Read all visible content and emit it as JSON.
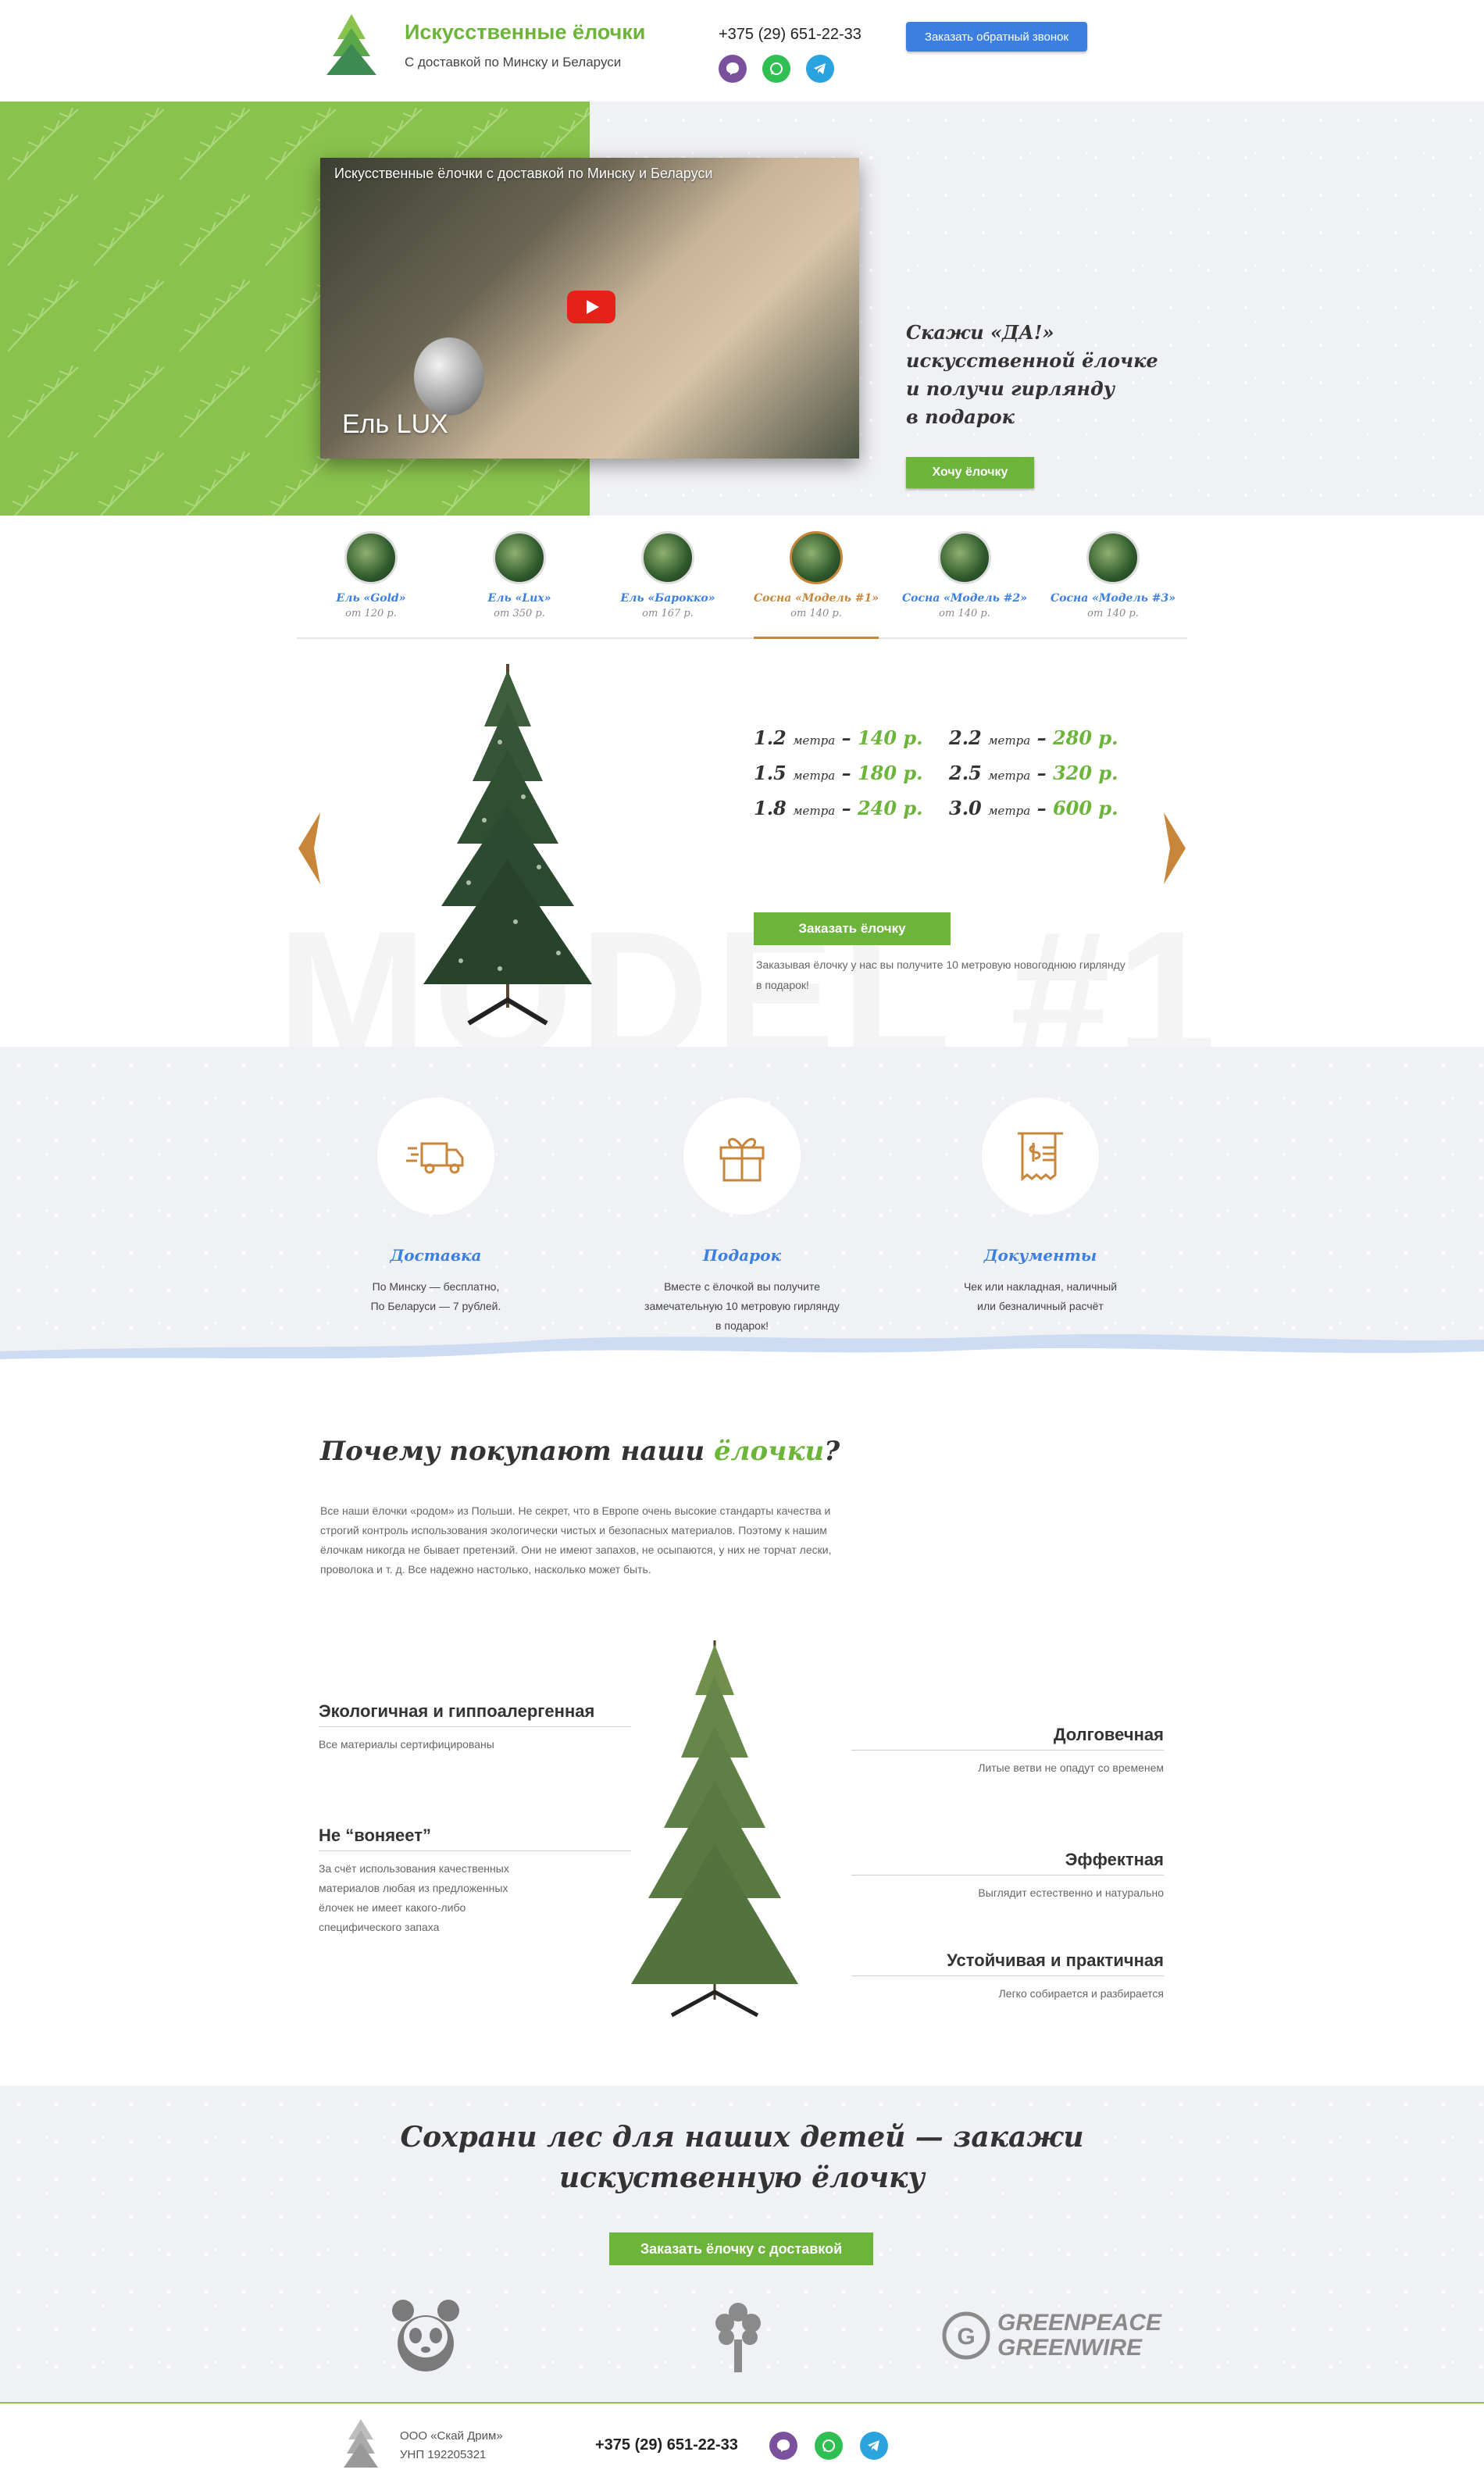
{
  "header": {
    "title": "Искусственные ёлочки",
    "subtitle": "С доставкой по Минску и Беларуси",
    "phone": "+375 (29) 651-22-33",
    "callback_label": "Заказать обратный звонок",
    "messengers": [
      "viber-icon",
      "whatsapp-icon",
      "telegram-icon"
    ]
  },
  "hero": {
    "video_title": "Искусственные ёлочки с доставкой по Минску и Беларуси",
    "video_caption": "Ель LUX",
    "headline_lines": [
      "Скажи «ДА!»",
      "искусственной ёлочке",
      "и получи гирлянду",
      "в подарок"
    ],
    "cta_label": "Хочу ёлочку"
  },
  "models": [
    {
      "name": "Ель «Gold»",
      "price": "от 120 р."
    },
    {
      "name": "Ель «Lux»",
      "price": "от 350 р."
    },
    {
      "name": "Ель «Барокко»",
      "price": "от 167 р."
    },
    {
      "name": "Сосна «Модель #1»",
      "price": "от 140 р.",
      "active": true
    },
    {
      "name": "Сосна «Модель #2»",
      "price": "от 140 р."
    },
    {
      "name": "Сосна «Модель #3»",
      "price": "от 140 р."
    }
  ],
  "product": {
    "watermark": "MODEL #1",
    "metre_word": "метра",
    "prices": [
      {
        "size": "1.2",
        "price": "140 р."
      },
      {
        "size": "2.2",
        "price": "280 р."
      },
      {
        "size": "1.5",
        "price": "180 р."
      },
      {
        "size": "2.5",
        "price": "320 р."
      },
      {
        "size": "1.8",
        "price": "240 р."
      },
      {
        "size": "3.0",
        "price": "600 р."
      }
    ],
    "order_label": "Заказать ёлочку",
    "order_note": "Заказывая ёлочку у нас вы получите 10 метровую новогоднюю гирлянду в подарок!"
  },
  "features": [
    {
      "icon": "truck-icon",
      "title": "Доставка",
      "text": "По Минску — бесплатно,\nПо Беларуси — 7 рублей."
    },
    {
      "icon": "gift-icon",
      "title": "Подарок",
      "text": "Вместе с ёлочкой вы получите\nзамечательную 10 метровую гирлянду\nв подарок!"
    },
    {
      "icon": "receipt-icon",
      "title": "Документы",
      "text": "Чек или накладная, наличный\nили безналичный расчёт"
    }
  ],
  "why": {
    "title_prefix": "Почему покупают наши ",
    "title_accent": "ёлочки",
    "title_suffix": "?",
    "text": "Все наши ёлочки «родом» из Польши. Не секрет, что в Европе очень высокие стандарты качества и строгий контроль использования экологически чистых и безопасных материалов. Поэтому к нашим ёлочкам никогда не бывает претензий. Они не имеют запахов, не осыпаются, у них не торчат лески, проволока и т. д. Все надежно настолько, насколько может быть.",
    "left": [
      {
        "title": "Экологичная и гиппоалергенная",
        "desc": "Все материалы сертифицированы"
      },
      {
        "title": "Не “воняеет”",
        "desc": "За счёт использования качественных материалов любая из предложенных ёлочек не имеет какого-либо специфического запаха"
      }
    ],
    "right": [
      {
        "title": "Долговечная",
        "desc": "Литые ветви не опадут со временем"
      },
      {
        "title": "Эффектная",
        "desc": "Выглядит естественно и натурально"
      },
      {
        "title": "Устойчивая и практичная",
        "desc": "Легко собирается и разбирается"
      }
    ]
  },
  "save": {
    "title_line1": "Сохрани лес для наших детей — закажи",
    "title_line2": "искуственную ёлочку",
    "cta_label": "Заказать ёлочку с доставкой",
    "greenpeace_line1": "GREENPEACE",
    "greenpeace_line2": "GREENWIRE"
  },
  "footer": {
    "company": "ООО «Скай Дрим»",
    "unp": "УНП 192205321",
    "phone": "+375 (29) 651-22-33"
  },
  "colors": {
    "green": "#6cb53a",
    "blue": "#3d7fe0",
    "orange": "#c8863a"
  }
}
